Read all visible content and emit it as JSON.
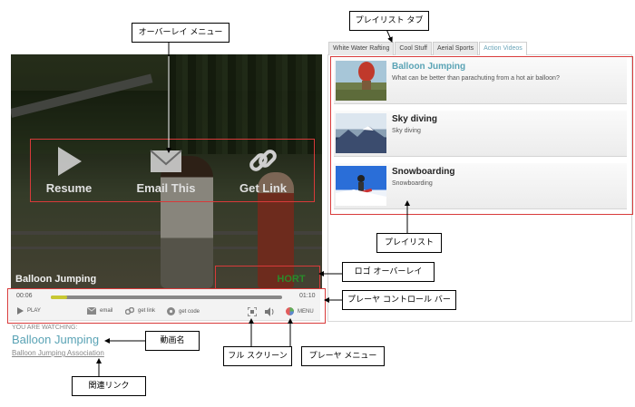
{
  "callouts": {
    "overlay_menu": "オーバーレイ メニュー",
    "playlist_tab": "プレイリスト タブ",
    "playlist": "プレイリスト",
    "logo_overlay": "ロゴ オーバーレイ",
    "player_control_bar": "プレーヤ コントロール バー",
    "video_name": "動画名",
    "full_screen": "フル スクリーン",
    "player_menu": "プレーヤ メニュー",
    "related_link": "関連リンク"
  },
  "overlay_menu": [
    {
      "label": "Resume",
      "icon": "play-icon"
    },
    {
      "label": "Email This",
      "icon": "envelope-icon"
    },
    {
      "label": "Get Link",
      "icon": "chain-link-icon"
    }
  ],
  "video": {
    "title": "Balloon Jumping",
    "logo": "HORT"
  },
  "controls": {
    "time_current": "00:06",
    "time_total": "01:10",
    "progress": 0.07,
    "play": "PLAY",
    "email": "email",
    "get_link": "get link",
    "get_code": "get code",
    "menu": "MENU"
  },
  "now_playing": {
    "caption": "YOU ARE WATCHING:",
    "title": "Balloon Jumping",
    "related": "Balloon Jumping Association"
  },
  "tabs": [
    {
      "label": "White Water Rafting",
      "active": false
    },
    {
      "label": "Cool Stuff",
      "active": false
    },
    {
      "label": "Aerial Sports",
      "active": false
    },
    {
      "label": "Action Videos",
      "active": true
    }
  ],
  "playlist": [
    {
      "title": "Balloon Jumping",
      "description": "What can be better than parachuting from a hot air balloon?",
      "title_color": "#5aa3b5"
    },
    {
      "title": "Sky diving",
      "description": "Sky diving",
      "title_color": "#222222"
    },
    {
      "title": "Snowboarding",
      "description": "Snowboarding",
      "title_color": "#222222"
    }
  ],
  "colors": {
    "annotation_red": "#d83a3a",
    "accent": "#5aa3b5",
    "progress_fill": "#c8c832"
  }
}
